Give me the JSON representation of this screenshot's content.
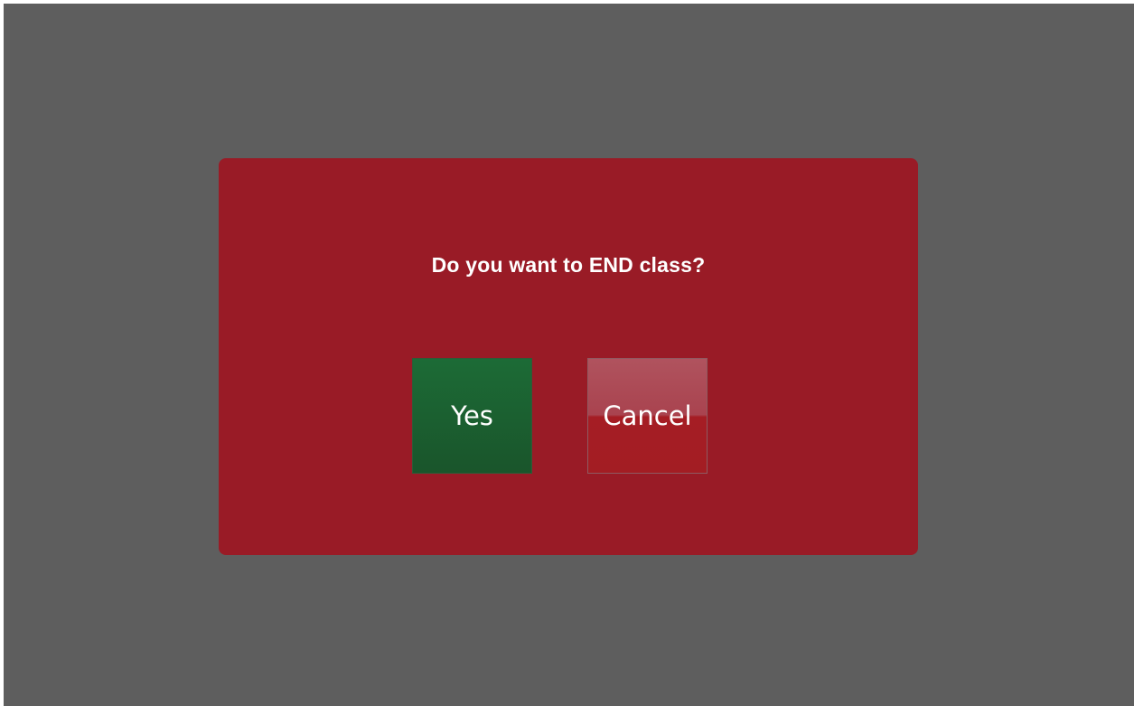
{
  "dialog": {
    "prompt": "Do you want to END class?",
    "yes_label": "Yes",
    "cancel_label": "Cancel"
  },
  "colors": {
    "backdrop": "#5e5e5e",
    "dialog_bg": "#991b26",
    "yes_button": "#1a5f30",
    "cancel_button": "#a31d23"
  }
}
